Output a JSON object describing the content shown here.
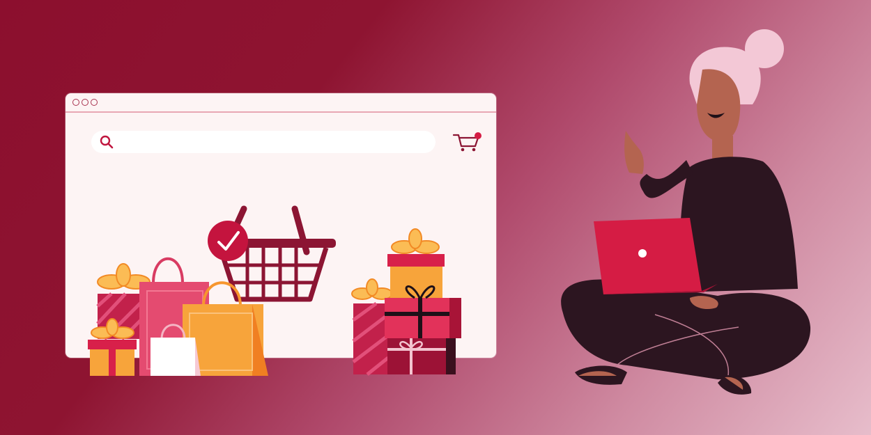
{
  "browser_window": {
    "search": {
      "value": "",
      "placeholder": ""
    }
  },
  "icons": {
    "search": "search-icon",
    "cart": "shopping-cart-icon",
    "basket": "shopping-basket-icon",
    "check": "check-badge-icon",
    "laptop": "laptop-icon"
  },
  "colors": {
    "brand_dark": "#8c0f2e",
    "accent_red": "#d51c44",
    "accent_orange": "#f7962e",
    "window_bg": "#fdf4f4"
  }
}
